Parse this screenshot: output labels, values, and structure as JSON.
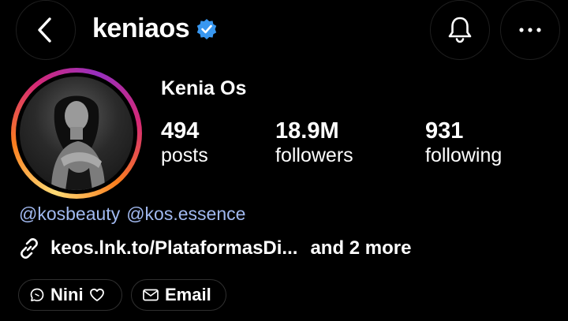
{
  "header": {
    "username": "keniaos",
    "verified": true,
    "icons": {
      "back": "chevron-left-icon",
      "notifications": "bell-icon",
      "more": "more-horizontal-icon"
    }
  },
  "profile": {
    "display_name": "Kenia Os",
    "stats": [
      {
        "value": "494",
        "label": "posts"
      },
      {
        "value": "18.9M",
        "label": "followers"
      },
      {
        "value": "931",
        "label": "following"
      }
    ],
    "bio_mentions": [
      "@kosbeauty",
      "@kos.essence"
    ],
    "link": {
      "text": "keos.lnk.to/PlataformasDi...",
      "more": "and 2 more"
    }
  },
  "actions": {
    "thread_label": "Nini",
    "email_label": "Email"
  },
  "colors": {
    "background": "#000000",
    "link_blue": "#a1b9f0",
    "verified_blue": "#3897f0"
  }
}
